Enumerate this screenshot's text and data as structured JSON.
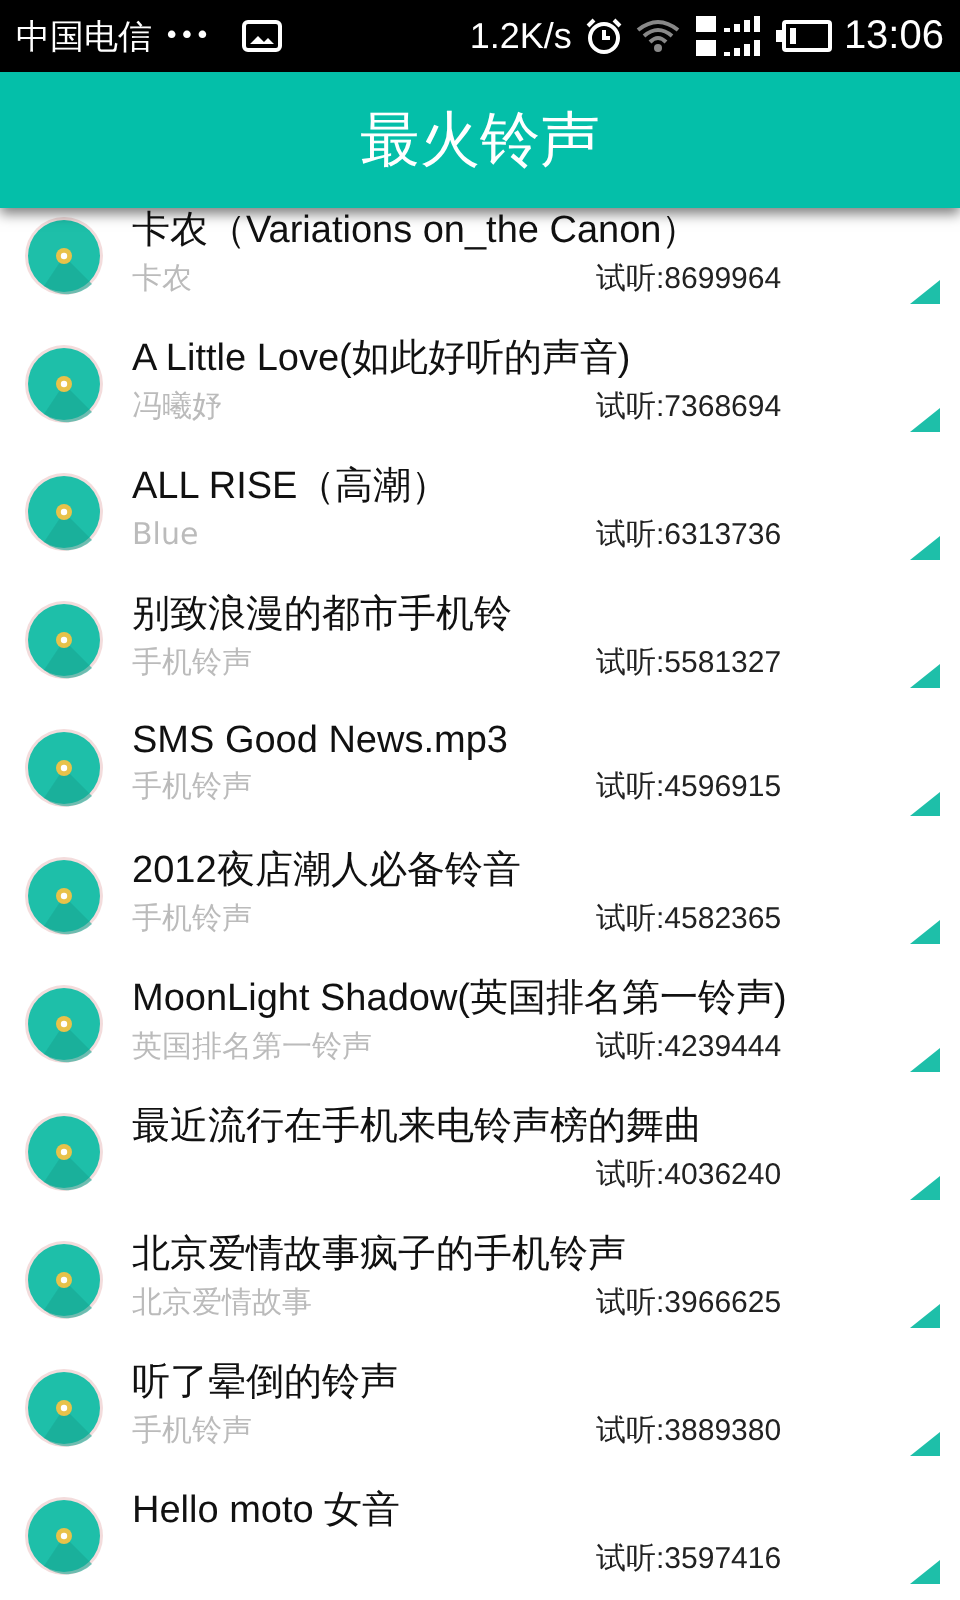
{
  "status_bar": {
    "carrier": "中国电信",
    "dots": "•••",
    "speed": "1.2K/s",
    "time": "13:06"
  },
  "header": {
    "title": "最火铃声"
  },
  "ringtones": [
    {
      "title": "卡农（Variations on_the Canon）",
      "artist": "卡农",
      "plays": "试听:8699964"
    },
    {
      "title": "A Little Love(如此好听的声音)",
      "artist": "冯曦妤",
      "plays": "试听:7368694"
    },
    {
      "title": "ALL RISE（高潮）",
      "artist": "Blue",
      "plays": "试听:6313736"
    },
    {
      "title": "别致浪漫的都市手机铃",
      "artist": "手机铃声",
      "plays": "试听:5581327"
    },
    {
      "title": "SMS Good News.mp3",
      "artist": "手机铃声",
      "plays": "试听:4596915"
    },
    {
      "title": "2012夜店潮人必备铃音",
      "artist": "手机铃声",
      "plays": "试听:4582365"
    },
    {
      "title": "MoonLight Shadow(英国排名第一铃声)",
      "artist": "英国排名第一铃声",
      "plays": "试听:4239444"
    },
    {
      "title": "最近流行在手机来电铃声榜的舞曲",
      "plays": "试听:4036240"
    },
    {
      "title": "北京爱情故事疯子的手机铃声",
      "artist": "北京爱情故事",
      "plays": "试听:3966625"
    },
    {
      "title": "听了晕倒的铃声",
      "artist": "手机铃声",
      "plays": "试听:3889380"
    },
    {
      "title": "Hello moto 女音",
      "plays": "试听:3597416"
    }
  ]
}
